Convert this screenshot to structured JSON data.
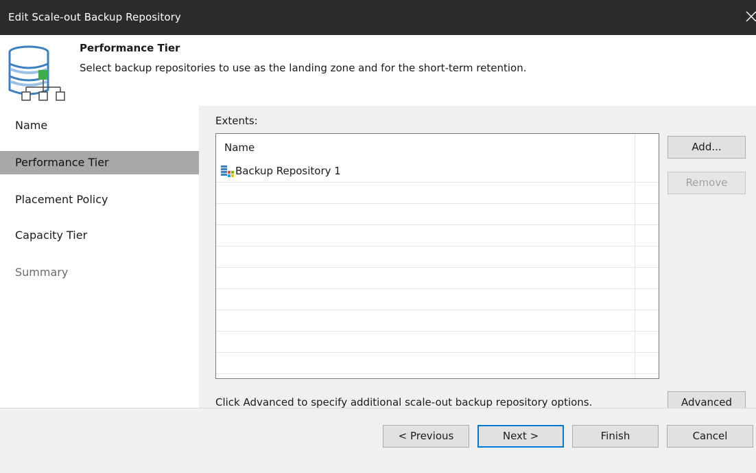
{
  "window": {
    "title": "Edit Scale-out Backup Repository",
    "close_icon": "close-icon"
  },
  "header": {
    "icon": "scale-out-repository-icon",
    "title": "Performance Tier",
    "subtitle": "Select backup repositories to use as the landing zone and for the short-term retention."
  },
  "nav": {
    "items": [
      {
        "label": "Name",
        "state": "normal"
      },
      {
        "label": "Performance Tier",
        "state": "active"
      },
      {
        "label": "Placement Policy",
        "state": "normal"
      },
      {
        "label": "Capacity Tier",
        "state": "normal"
      },
      {
        "label": "Summary",
        "state": "disabled"
      }
    ]
  },
  "extents": {
    "label": "Extents:",
    "columns": [
      "Name"
    ],
    "rows": [
      {
        "name": "Backup Repository 1",
        "icon": "backup-repository-icon"
      }
    ]
  },
  "side_buttons": {
    "add": "Add...",
    "remove": "Remove"
  },
  "advanced": {
    "hint": "Click Advanced to specify additional scale-out backup repository options.",
    "button": "Advanced"
  },
  "footer": {
    "previous": "< Previous",
    "next": "Next >",
    "finish": "Finish",
    "cancel": "Cancel"
  },
  "colors": {
    "titlebar": "#2b2b2b",
    "selected_nav": "#a8a8a8",
    "focus_border": "#0078d7",
    "repo_icon_green": "#3fae49",
    "repo_icon_blue": "#3c7fc3"
  }
}
